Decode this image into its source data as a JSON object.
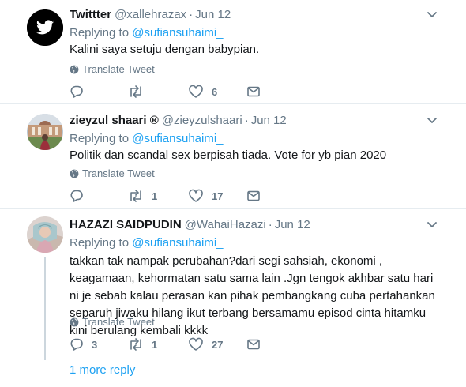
{
  "tweets": [
    {
      "name": "Twittter",
      "handle": "@xallehrazax",
      "dot": "·",
      "date": "Jun 12",
      "replying_prefix": "Replying to ",
      "replying_to": "@sufiansuhaimi_",
      "text": "Kalini saya setuju dengan babypian.",
      "translate": "Translate Tweet",
      "reply_count": "",
      "retweet_count": "",
      "like_count": "6"
    },
    {
      "name": "zieyzul shaari ®",
      "handle": "@zieyzulshaari",
      "dot": "·",
      "date": "Jun 12",
      "replying_prefix": "Replying to ",
      "replying_to": "@sufiansuhaimi_",
      "text": "Politik dan scandal sex berpisah tiada. Vote for yb pian 2020",
      "translate": "Translate Tweet",
      "reply_count": "",
      "retweet_count": "1",
      "like_count": "17"
    },
    {
      "name": "HAZAZI SAIDPUDIN",
      "handle": "@WahaiHazazi",
      "dot": "·",
      "date": "Jun 12",
      "replying_prefix": "Replying to ",
      "replying_to": "@sufiansuhaimi_",
      "text": "takkan tak nampak perubahan?dari segi sahsiah, ekonomi , keagamaan, kehormatan satu sama lain .Jgn tengok akhbar satu hari ni je sebab kalau perasan kan pihak pembangkang cuba pertahankan separuh jiwaku hilang ikut terbang bersamamu episod cinta hitamku kini berulang kembali kkkk",
      "translate": "Translate Tweet",
      "reply_count": "3",
      "retweet_count": "1",
      "like_count": "27"
    }
  ],
  "more_reply": "1 more reply",
  "colors": {
    "accent": "#1da1f2",
    "secondary_text": "#657786",
    "divider": "#e6ecf0"
  },
  "icons": [
    "twitter-bird-icon",
    "chevron-down-icon",
    "globe-icon",
    "reply-icon",
    "retweet-icon",
    "like-icon",
    "dm-icon"
  ]
}
